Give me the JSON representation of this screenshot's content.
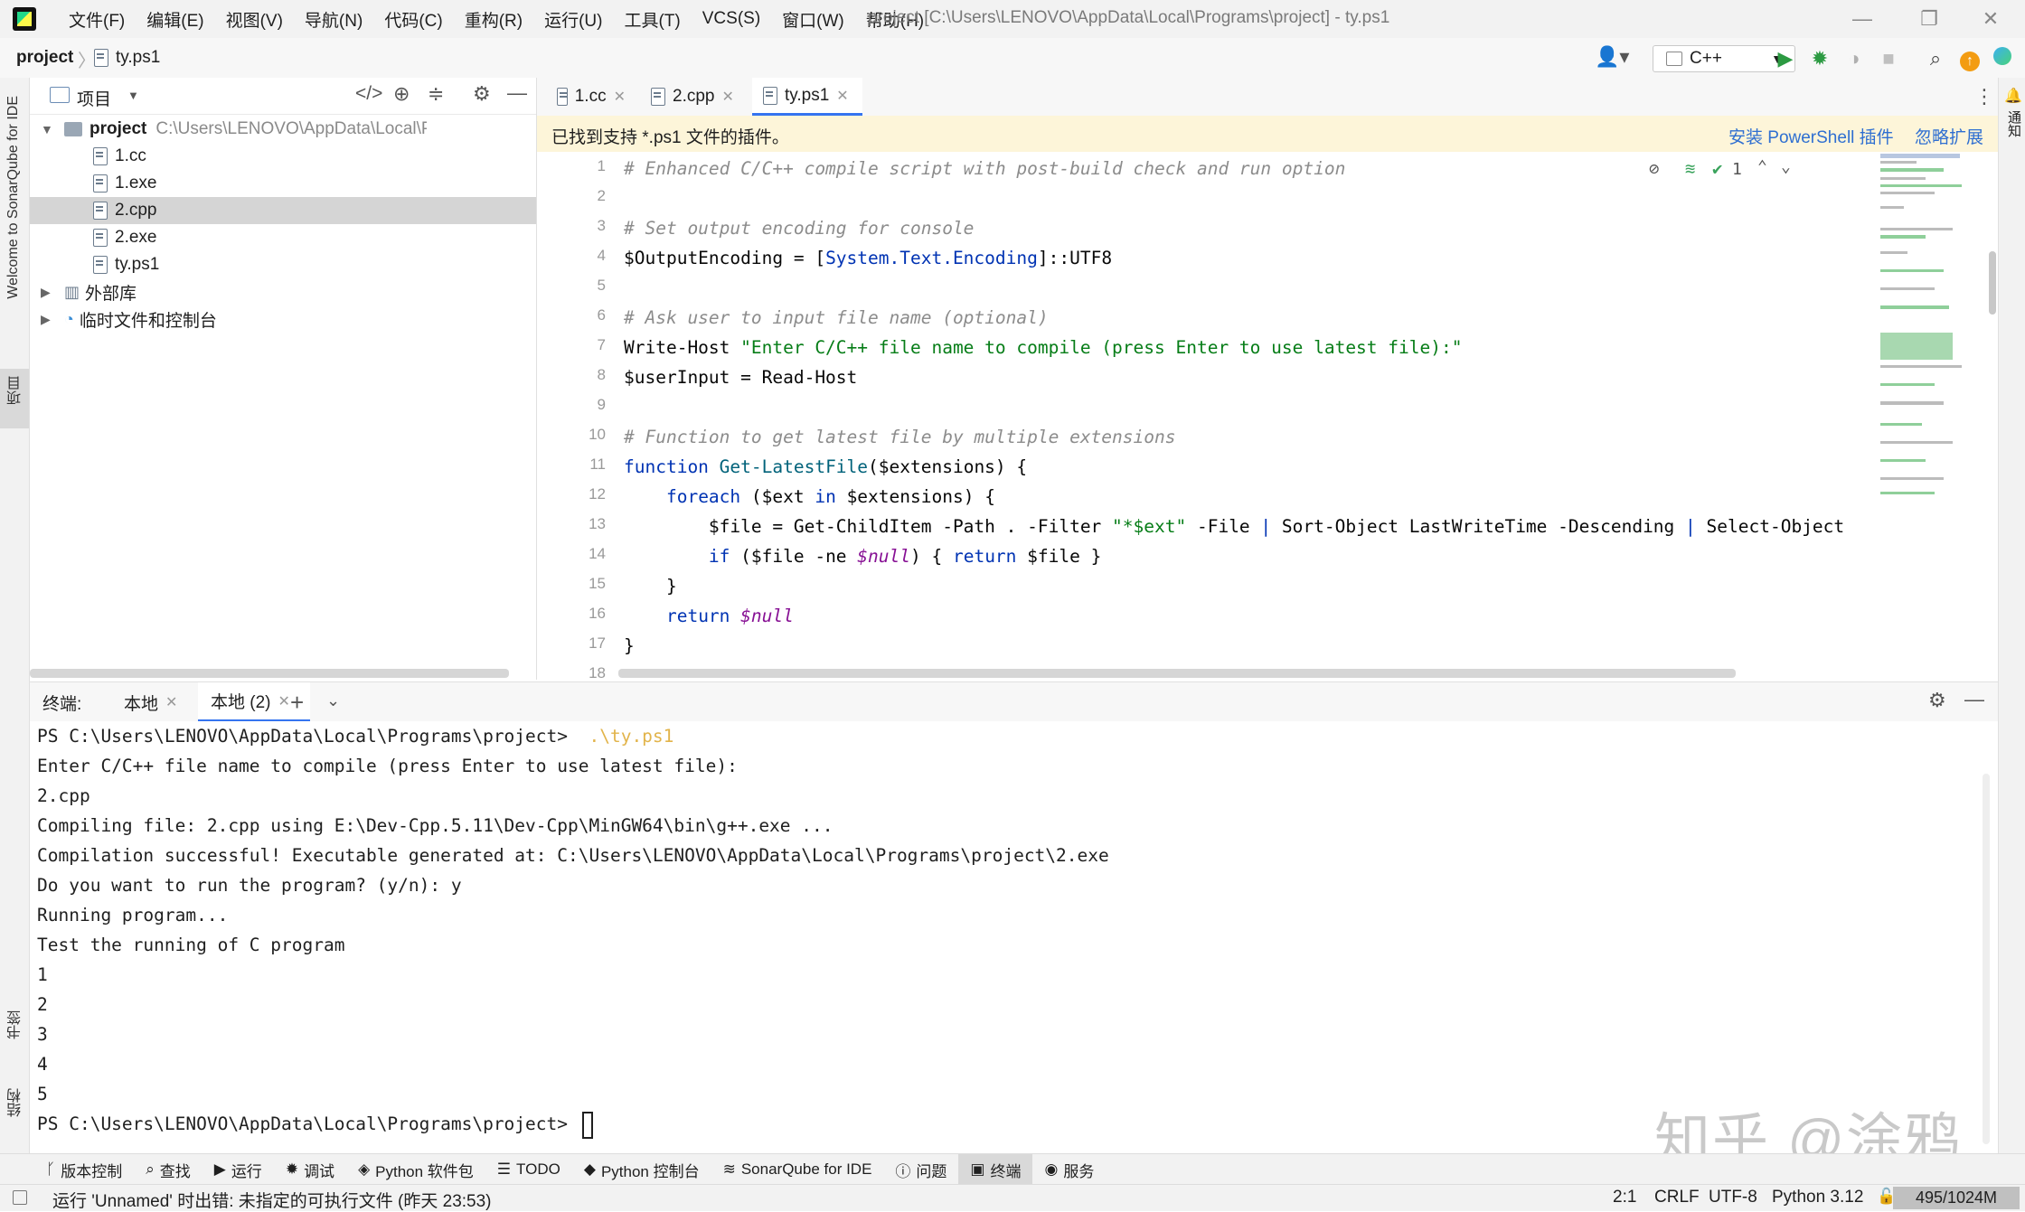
{
  "window": {
    "title": "project [C:\\Users\\LENOVO\\AppData\\Local\\Programs\\project] - ty.ps1",
    "menu": [
      "文件(F)",
      "编辑(E)",
      "视图(V)",
      "导航(N)",
      "代码(C)",
      "重构(R)",
      "运行(U)",
      "工具(T)",
      "VCS(S)",
      "窗口(W)",
      "帮助(H)"
    ]
  },
  "breadcrumb": {
    "project": "project",
    "file": "ty.ps1"
  },
  "run_config": {
    "label": "C++"
  },
  "left_stripe": {
    "sonar": "Welcome to SonarQube for IDE",
    "project": "项目",
    "bookmarks": "书签",
    "structure": "结构"
  },
  "right_stripe": {
    "notifications": "通知"
  },
  "project_panel": {
    "title": "项目",
    "root_name": "project",
    "root_path": "C:\\Users\\LENOVO\\AppData\\Local\\Programs\\proj",
    "files": [
      "1.cc",
      "1.exe",
      "2.cpp",
      "2.exe",
      "ty.ps1"
    ],
    "selected_file": "2.cpp",
    "external_libs": "外部库",
    "scratches": "临时文件和控制台"
  },
  "editor": {
    "tabs": [
      "1.cc",
      "2.cpp",
      "ty.ps1"
    ],
    "active_tab": "ty.ps1",
    "banner": {
      "message": "已找到支持 *.ps1 文件的插件。",
      "install": "安装 PowerShell 插件",
      "ignore": "忽略扩展"
    },
    "inspection_count": "1",
    "line_numbers": [
      "1",
      "2",
      "3",
      "4",
      "5",
      "6",
      "7",
      "8",
      "9",
      "10",
      "11",
      "12",
      "13",
      "14",
      "15",
      "16",
      "17",
      "18"
    ]
  },
  "terminal": {
    "label": "终端:",
    "tabs": [
      "本地",
      "本地 (2)"
    ],
    "prompt": "PS C:\\Users\\LENOVO\\AppData\\Local\\Programs\\project>",
    "command": ".\\ty.ps1",
    "lines": [
      "Enter C/C++ file name to compile (press Enter to use latest file):",
      "2.cpp",
      "Compiling file: 2.cpp using E:\\Dev-Cpp.5.11\\Dev-Cpp\\MinGW64\\bin\\g++.exe ...",
      "Compilation successful! Executable generated at: C:\\Users\\LENOVO\\AppData\\Local\\Programs\\project\\2.exe",
      "Do you want to run the program? (y/n): y",
      "Running program...",
      "Test the running of C program",
      "1",
      "2",
      "3",
      "4",
      "5"
    ],
    "final_prompt": "PS C:\\Users\\LENOVO\\AppData\\Local\\Programs\\project>"
  },
  "watermark": "知乎 @涂鸦",
  "tool_windows": [
    "版本控制",
    "查找",
    "运行",
    "调试",
    "Python 软件包",
    "TODO",
    "Python 控制台",
    "SonarQube for IDE",
    "问题",
    "终端",
    "服务"
  ],
  "active_tool_window": "终端",
  "status": {
    "message": "运行 'Unnamed' 时出错: 未指定的可执行文件 (昨天 23:53)",
    "position": "2:1",
    "line_sep": "CRLF",
    "encoding": "UTF-8",
    "interpreter": "Python 3.12",
    "memory": "495/1024M"
  },
  "colors": {
    "accent": "#3574f0",
    "banner_bg": "#fdf5d9",
    "selected_row": "#d5d5d5",
    "string": "#067d17",
    "keyword": "#0033b3",
    "comment": "#8c8c8c"
  }
}
